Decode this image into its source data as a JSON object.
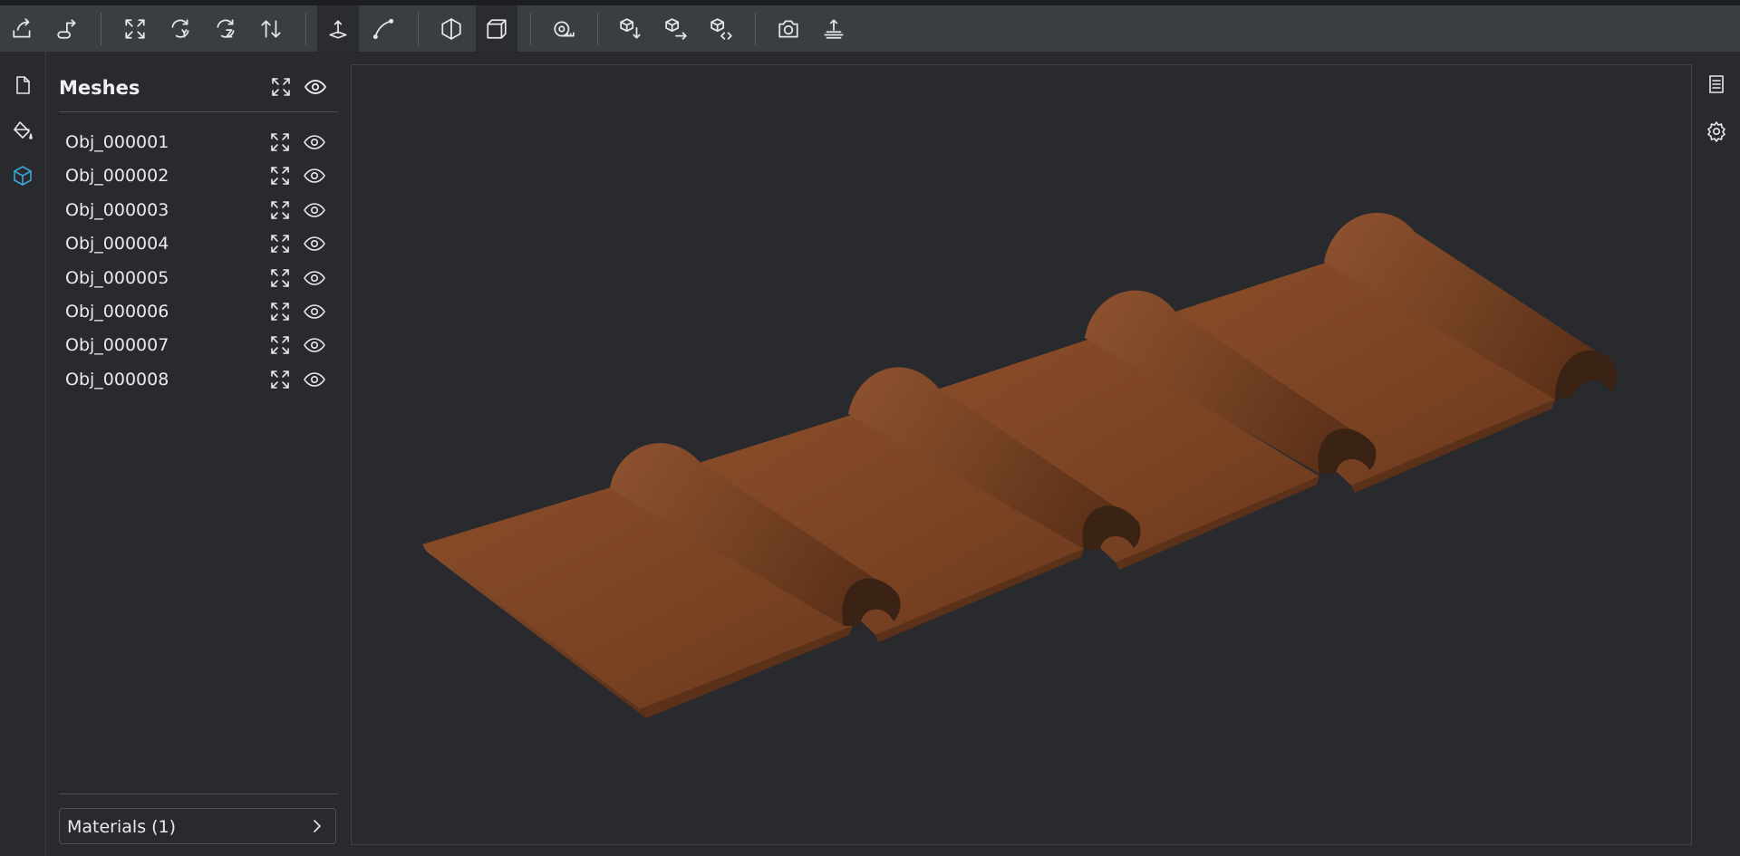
{
  "toolbar": {
    "buttons": [
      {
        "icon": "import-icon",
        "active": false
      },
      {
        "icon": "export-icon",
        "active": false
      },
      {
        "icon": "fit-view-icon",
        "active": false
      },
      {
        "icon": "rotate-y-icon",
        "active": false
      },
      {
        "icon": "rotate-z-icon",
        "active": false
      },
      {
        "icon": "flip-axes-icon",
        "active": false
      },
      {
        "icon": "up-axis-icon",
        "active": true
      },
      {
        "icon": "curve-tool-icon",
        "active": false
      },
      {
        "icon": "wireframe-toggle-icon",
        "active": false
      },
      {
        "icon": "solid-view-icon",
        "active": true
      },
      {
        "icon": "measure-tape-icon",
        "active": false
      },
      {
        "icon": "cube-down-icon",
        "active": false
      },
      {
        "icon": "cube-right-icon",
        "active": false
      },
      {
        "icon": "cube-code-icon",
        "active": false
      },
      {
        "icon": "camera-icon",
        "active": false
      },
      {
        "icon": "ground-plane-icon",
        "active": false
      }
    ]
  },
  "left_rail": {
    "items": [
      {
        "icon": "file-icon",
        "active": false
      },
      {
        "icon": "paint-bucket-icon",
        "active": false
      },
      {
        "icon": "cube-icon",
        "active": true
      }
    ],
    "active_color": "#3aa6d6"
  },
  "meshes_panel": {
    "title": "Meshes",
    "items": [
      {
        "label": "Obj_000001"
      },
      {
        "label": "Obj_000002"
      },
      {
        "label": "Obj_000003"
      },
      {
        "label": "Obj_000004"
      },
      {
        "label": "Obj_000005"
      },
      {
        "label": "Obj_000006"
      },
      {
        "label": "Obj_000007"
      },
      {
        "label": "Obj_000008"
      }
    ],
    "materials_label": "Materials (1)"
  },
  "right_rail": {
    "items": [
      {
        "icon": "list-icon"
      },
      {
        "icon": "settings-icon"
      }
    ]
  },
  "colors": {
    "background": "#282a2e",
    "toolbar": "#3a3d42",
    "model": "#7a4424"
  }
}
